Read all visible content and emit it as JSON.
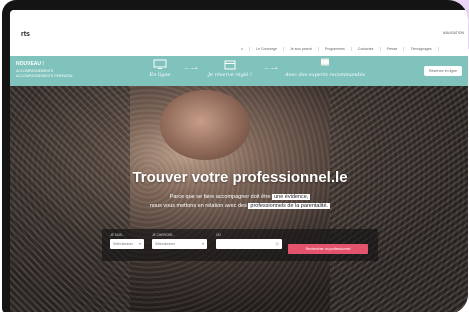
{
  "header": {
    "logo": "rts",
    "mini_right": "NAVIGATION",
    "nav": [
      {
        "label": "⌂",
        "active": true
      },
      {
        "label": "Le Concierge"
      },
      {
        "label": "Je suis parent"
      },
      {
        "label": "Programmes"
      },
      {
        "label": "Contactez"
      },
      {
        "label": "Presse"
      },
      {
        "label": "Témoignages"
      }
    ]
  },
  "banner": {
    "title": "NOUVEAU !",
    "subtitle": "ACCOMPAGNEMENTS\nACCOMPAGNEMENTS PERINATAL",
    "steps": [
      {
        "label": "En ligne",
        "icon": "computer-icon"
      },
      {
        "label": "Je réserve réglé !",
        "icon": "calendar-icon"
      },
      {
        "label": "Avec des experts recommandés",
        "icon": "experts-icon"
      }
    ],
    "cta": "Réservez en ligne"
  },
  "hero": {
    "title": "Trouver votre professionnel.le",
    "line1_pre": "Parce que se faire accompagner doit être",
    "line1_hl": "une évidence,",
    "line2_pre": "nous vous mettons en relation avec des",
    "line2_hl": "professionnels de la parentalité."
  },
  "search": {
    "fields": [
      {
        "label": "JE SUIS...",
        "value": "Sélectionnez"
      },
      {
        "label": "JE CHERCHE...",
        "value": "Sélectionnez"
      },
      {
        "label": "OÙ",
        "value": ""
      }
    ],
    "button": "Rechercher un professionnel"
  }
}
